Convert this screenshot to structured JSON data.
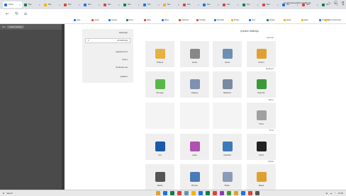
{
  "browser": {
    "tabs": [
      {
        "label": "Settin",
        "color": "#1a73e8",
        "active": true
      },
      {
        "label": "Nav",
        "color": "#0b8043"
      },
      {
        "label": "Nav",
        "color": "#f4b400"
      },
      {
        "label": "Nav",
        "color": "#db4437"
      },
      {
        "label": "Nav",
        "color": "#1a73e8"
      },
      {
        "label": "Nav",
        "color": "#db4437"
      },
      {
        "label": "Nav",
        "color": "#0b8043"
      },
      {
        "label": "Nav",
        "color": "#1a73e8"
      },
      {
        "label": "Nav",
        "color": "#f4b400"
      },
      {
        "label": "Nav",
        "color": "#db4437"
      },
      {
        "label": "Nav",
        "color": "#1a73e8"
      },
      {
        "label": "Nav",
        "color": "#db4437"
      },
      {
        "label": "Nav",
        "color": "#0b8043"
      },
      {
        "label": "Nav",
        "color": "#db4437"
      },
      {
        "label": "Nav",
        "color": "#1a73e8"
      },
      {
        "label": "Nav",
        "color": "#db4437"
      },
      {
        "label": "Nav",
        "color": "#0b8043"
      }
    ],
    "new_tab": "+",
    "window_controls": [
      "–",
      "□",
      "×"
    ],
    "nav": {
      "back": "←",
      "refresh": "↻",
      "home": "⌂"
    },
    "url": "localhost/system/settings",
    "addr_icons": [
      "☆",
      "⟳",
      "⋮"
    ],
    "bookmarks": [
      {
        "label": "Apps",
        "color": "#1a73e8"
      },
      {
        "label": "Gmail",
        "color": "#db4437"
      },
      {
        "label": "Google",
        "color": "#1a73e8"
      },
      {
        "label": "Drive",
        "color": "#0b8043"
      },
      {
        "label": "Maps",
        "color": "#db4437"
      },
      {
        "label": "News",
        "color": "#1a73e8"
      },
      {
        "label": "Calendar",
        "color": "#db4437"
      },
      {
        "label": "YouTube",
        "color": "#db4437"
      },
      {
        "label": "Translate",
        "color": "#1a73e8"
      },
      {
        "label": "Photos",
        "color": "#f4b400"
      },
      {
        "label": "Docs",
        "color": "#1a73e8"
      },
      {
        "label": "Sheets",
        "color": "#0b8043"
      },
      {
        "label": "Slides",
        "color": "#f4b400"
      },
      {
        "label": "Keep",
        "color": "#f4b400"
      },
      {
        "label": "Contacts",
        "color": "#1a73e8"
      },
      {
        "label": "Other bookmarks",
        "color": "#f4b400"
      }
    ]
  },
  "left_panel": {
    "title": "Main",
    "chip": "System Settings"
  },
  "settings_pane": {
    "header": "Settings",
    "dropdown_value": "All Settings",
    "dropdown_arrow": "▾",
    "items": [
      "Appearance",
      "Users",
      "Preferences",
      "System"
    ]
  },
  "content": {
    "title": "System Settings",
    "sections": [
      "General",
      "Network",
      "Other",
      "Tools",
      "Media"
    ],
    "tiles": [
      {
        "label": "Admin",
        "icon": "user-icon",
        "color": "#e0a030"
      },
      {
        "label": "Users",
        "icon": "users-icon",
        "color": "#6b8fb3"
      },
      {
        "label": "Audio",
        "icon": "speaker-icon",
        "color": "#888888"
      },
      {
        "label": "Folders",
        "icon": "folder-icon",
        "color": "#e8b040"
      },
      {
        "label": "Reports",
        "icon": "chart-icon",
        "color": "#3a9a3a"
      },
      {
        "label": "Network",
        "icon": "network-icon",
        "color": "#7a8aa0"
      },
      {
        "label": "Display",
        "icon": "display-icon",
        "color": "#8090b0"
      },
      {
        "label": "Storage",
        "icon": "database-icon",
        "color": "#5ab84a"
      },
      {
        "label": "Tools",
        "icon": "tools-icon",
        "color": "#a0a0a0"
      },
      {
        "label": "Clock",
        "icon": "clock-icon",
        "color": "#222222"
      },
      {
        "label": "Updates",
        "icon": "globe-icon",
        "color": "#3a7ab8"
      },
      {
        "label": "Apps",
        "icon": "grid-icon",
        "color": "#b050b0"
      },
      {
        "label": "Info",
        "icon": "info-icon",
        "color": "#1a5aa8"
      },
      {
        "label": "Notes",
        "icon": "notes-icon",
        "color": "#e0a030"
      },
      {
        "label": "Editor",
        "icon": "edit-icon",
        "color": "#8a9ab8"
      },
      {
        "label": "Photos",
        "icon": "image-icon",
        "color": "#4a7ab8"
      },
      {
        "label": "Media",
        "icon": "film-icon",
        "color": "#555555"
      }
    ]
  },
  "taskbar": {
    "start_label": "Search",
    "apps": [
      "#e0a030",
      "#1a73e8",
      "#0b8043",
      "#db4437",
      "#6b8fb3",
      "#f4b400",
      "#1a73e8",
      "#0b8043",
      "#db4437",
      "#8a3ab8",
      "#3a9a3a",
      "#e0a030",
      "#1a73e8",
      "#db4437",
      "#555555"
    ],
    "time": "12:00",
    "tray": [
      "^",
      "☁",
      "🔊"
    ]
  }
}
